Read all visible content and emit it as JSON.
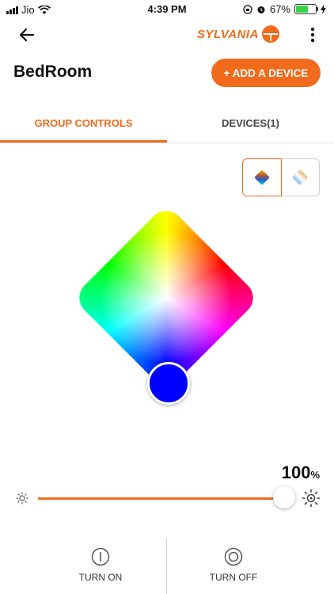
{
  "status_bar": {
    "carrier": "Jio",
    "time": "4:39 PM",
    "battery": "67%",
    "battery_level": 0.67,
    "battery_color": "#3bd14a"
  },
  "app_bar": {
    "brand": "SYLVANIA",
    "brand_color": "#f26a1b",
    "back_icon": "back-arrow-icon",
    "menu_icon": "more-vert-icon"
  },
  "header": {
    "title": "BedRoom",
    "add_button_label": "+ ADD A DEVICE"
  },
  "tabs": [
    {
      "label": "GROUP CONTROLS",
      "active": true
    },
    {
      "label": "DEVICES(1)",
      "active": false
    }
  ],
  "color_mode": {
    "options": [
      "color-wheel-icon",
      "white-temperature-icon"
    ],
    "selected": "color-wheel-icon",
    "selected_color": "#0000ff"
  },
  "brightness": {
    "value": "100",
    "unit": "%",
    "level": 1.0
  },
  "actions": {
    "turn_on": "TURN ON",
    "turn_off": "TURN OFF"
  }
}
